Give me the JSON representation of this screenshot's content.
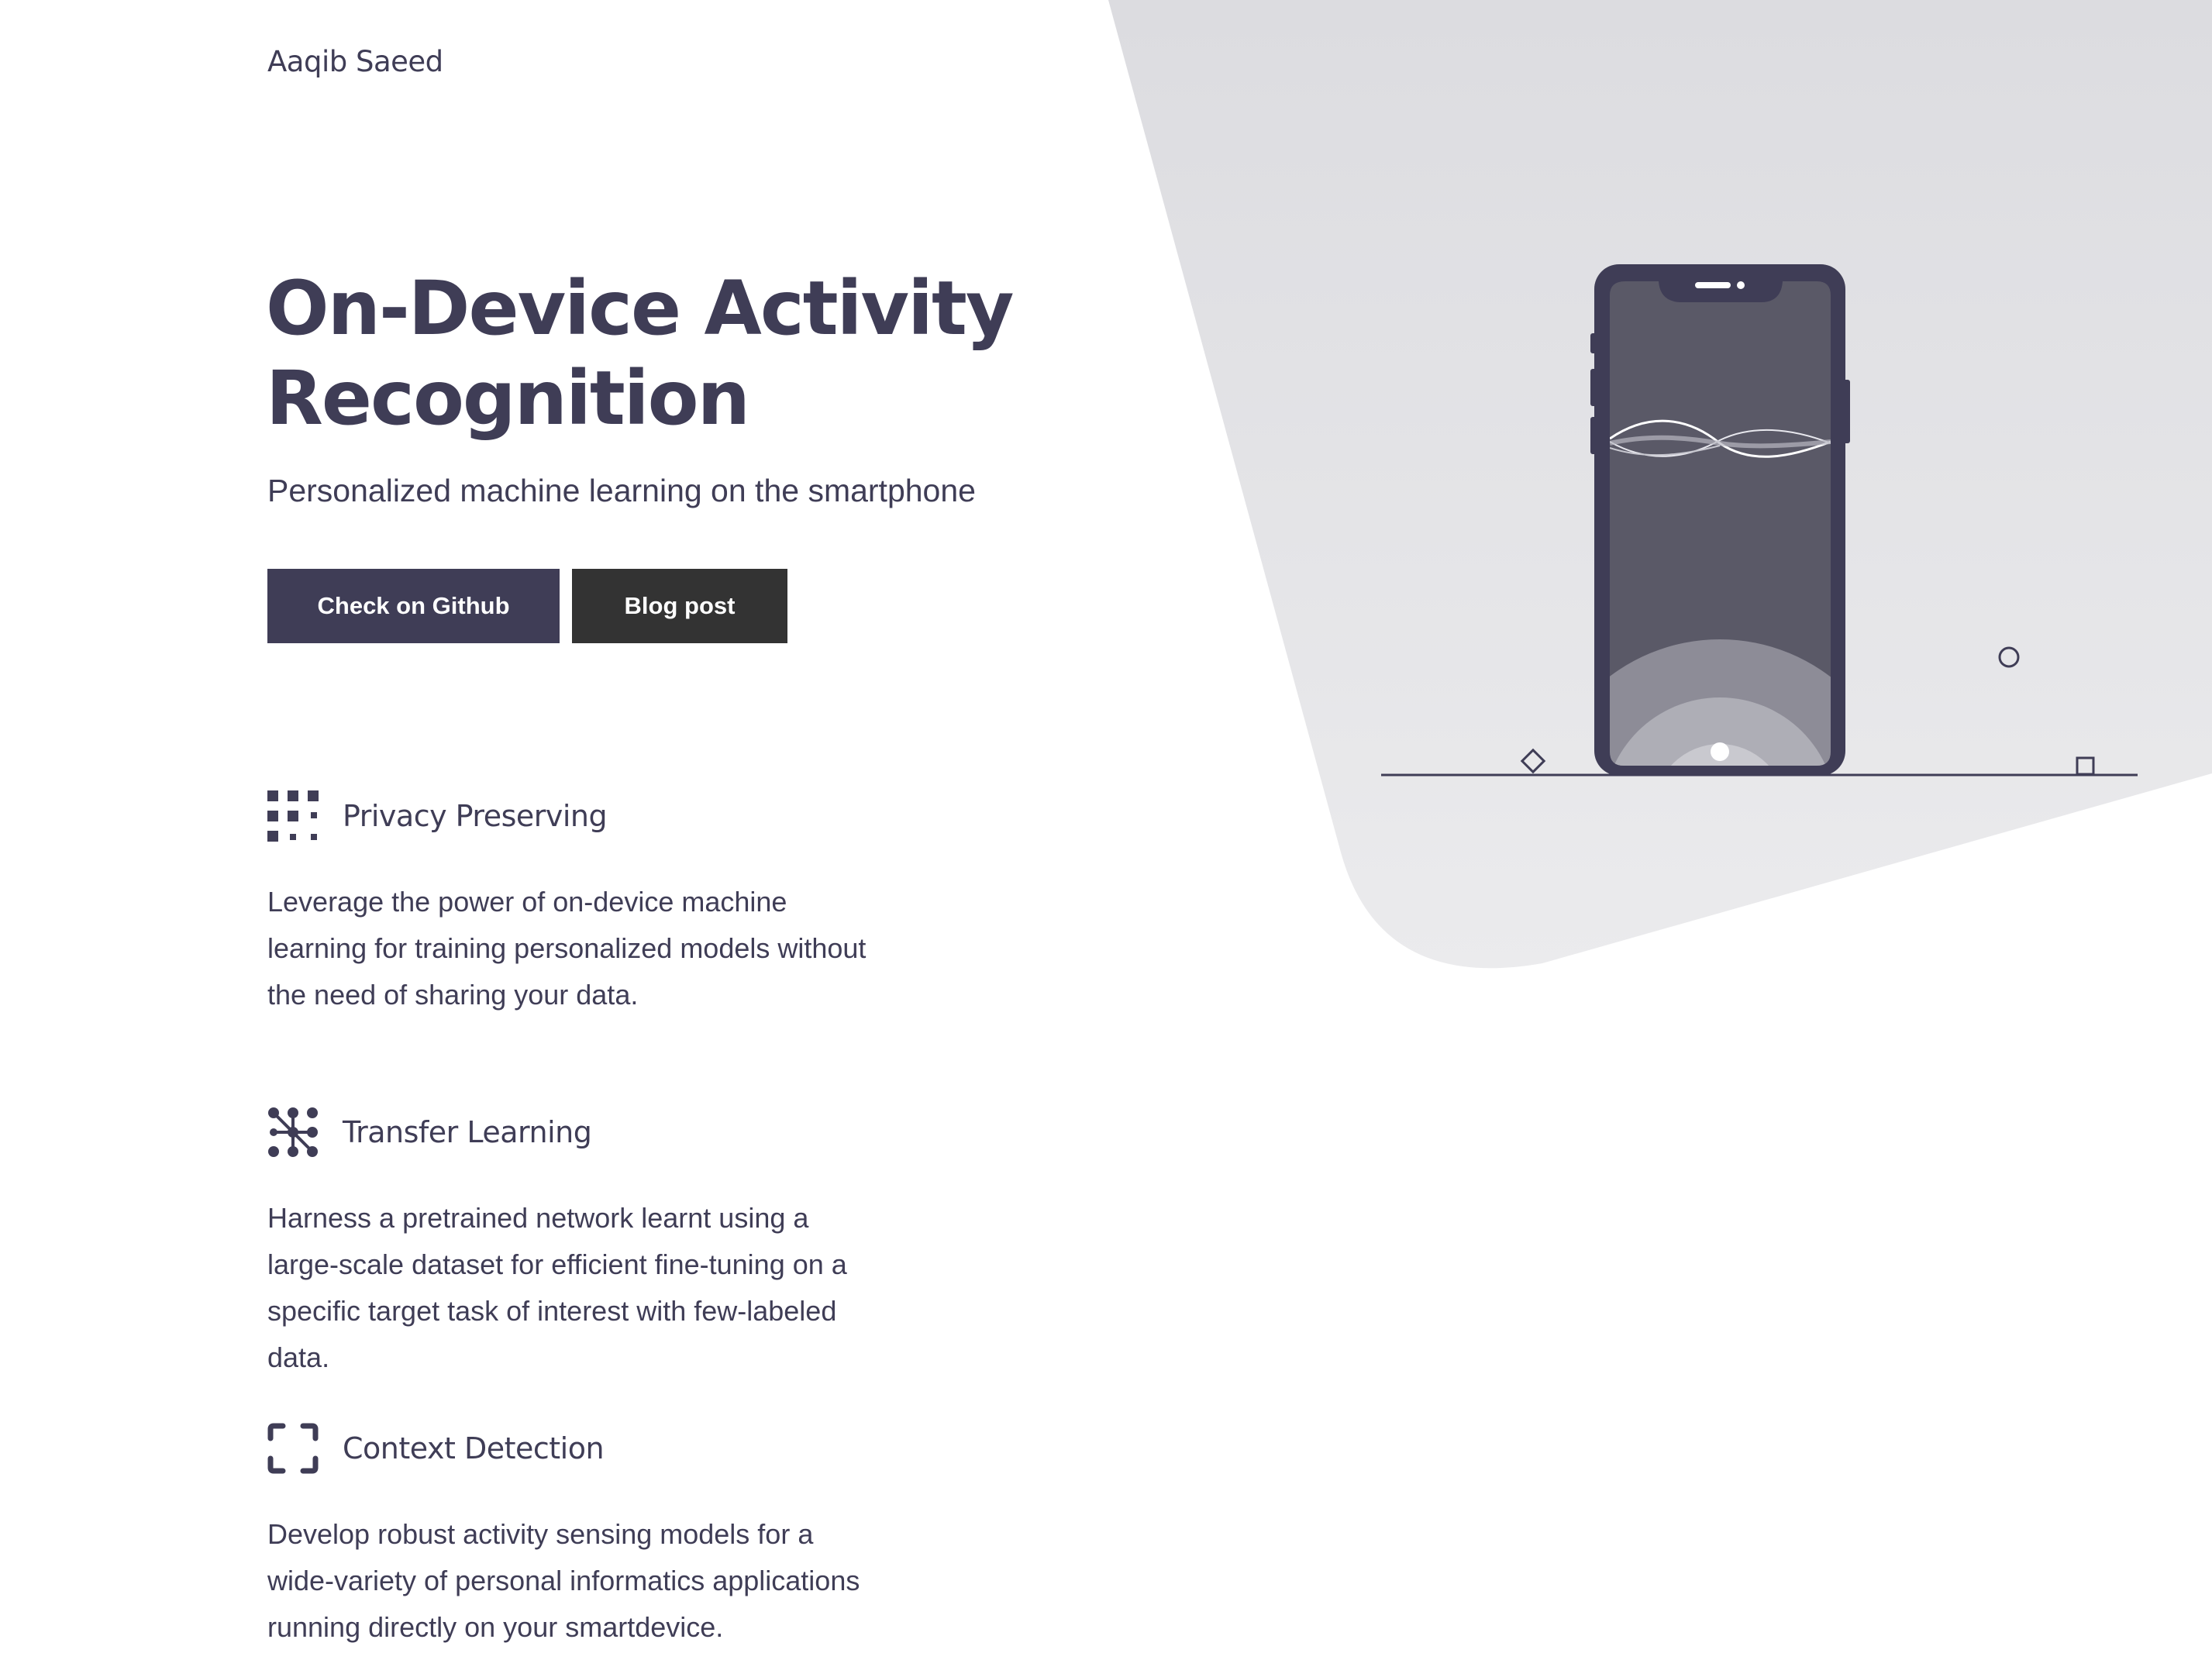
{
  "header": {
    "brand": "Aaqib Saeed"
  },
  "hero": {
    "title": "On-Device Activity Recognition",
    "subtitle": "Personalized machine learning on the smartphone",
    "buttons": {
      "github": "Check on Github",
      "blog": "Blog post"
    }
  },
  "features": [
    {
      "icon": "grid-dots-icon",
      "title": "Privacy Preserving",
      "text": "Leverage the power of on-device machine learning for training personalized models without the need of sharing your data."
    },
    {
      "icon": "network-dots-icon",
      "title": "Transfer Learning",
      "text": "Harness a pretrained network learnt using a large-scale dataset for efficient fine-tuning on a specific target task of interest with few-labeled data."
    },
    {
      "icon": "focus-frame-icon",
      "title": "Context Detection",
      "text": "Develop robust activity sensing models for a wide-variety of personal informatics applications running directly on your smartdevice."
    }
  ],
  "colors": {
    "primary": "#3f3d56",
    "secondary_button": "#333333",
    "background_shape": "#e6e6ea"
  }
}
